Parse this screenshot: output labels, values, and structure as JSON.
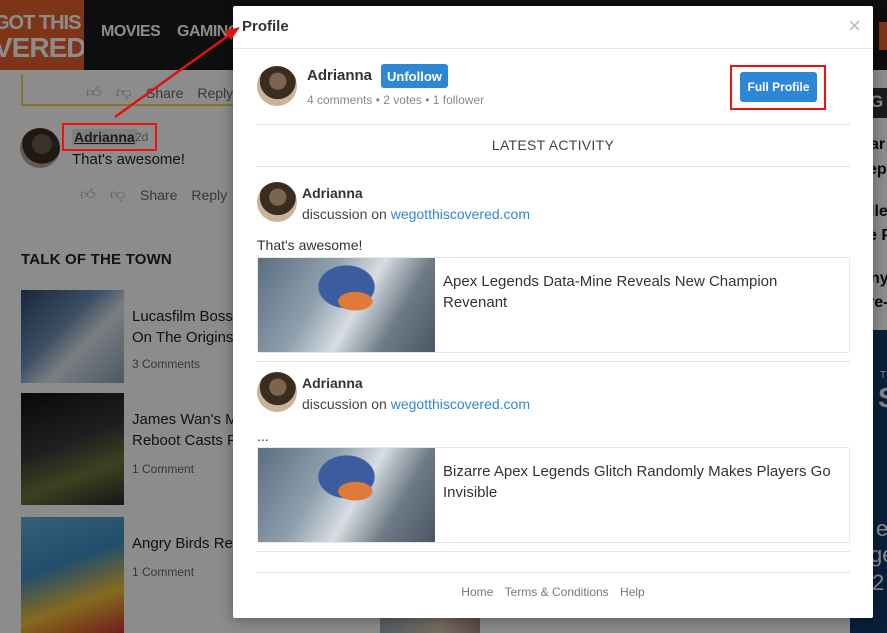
{
  "site": {
    "logo_line1": "GOT THIS",
    "logo_line2": "VERED",
    "nav": [
      "MOVIES",
      "GAMING"
    ]
  },
  "bg_comment_prev": {
    "share": "Share",
    "reply": "Reply"
  },
  "bg_comment": {
    "username": "Adrianna",
    "time": "2d",
    "text": "That's awesome!",
    "share": "Share",
    "reply": "Reply"
  },
  "talk_of_town": {
    "heading": "TALK OF THE TOWN",
    "stories": [
      {
        "title": "Lucasfilm Boss",
        "title2": "On The Origins",
        "comments": "3 Comments"
      },
      {
        "title": "James Wan's M",
        "title2": "Reboot Casts F",
        "comments": "1 Comment"
      },
      {
        "title": "Angry Birds Re",
        "title2": "",
        "comments": "1 Comment"
      }
    ]
  },
  "right_fragments": [
    "G",
    "ar",
    "ep",
    "lle",
    "e P",
    "ny",
    "re-",
    "T",
    "S",
    "e",
    "ge",
    "2"
  ],
  "modal": {
    "title": "Profile",
    "close": "×",
    "profile": {
      "name": "Adrianna",
      "unfollow_label": "Unfollow",
      "stats": "4 comments • 2 votes • 1 follower",
      "full_profile_label": "Full Profile"
    },
    "latest_activity_label": "LATEST ACTIVITY",
    "activities": [
      {
        "name": "Adrianna",
        "prefix": "discussion on ",
        "site": "wegotthiscovered.com",
        "text": "That's awesome!",
        "card_title": "Apex Legends Data-Mine Reveals New Champion Revenant"
      },
      {
        "name": "Adrianna",
        "prefix": "discussion on ",
        "site": "wegotthiscovered.com",
        "text": "...",
        "card_title": "Bizarre Apex Legends Glitch Randomly Makes Players Go Invisible"
      }
    ],
    "footer": [
      "Home",
      "Terms & Conditions",
      "Help"
    ]
  },
  "colors": {
    "accent_blue": "#2e87d4",
    "brand_orange": "#e5622a",
    "highlight_red": "#e11111"
  }
}
